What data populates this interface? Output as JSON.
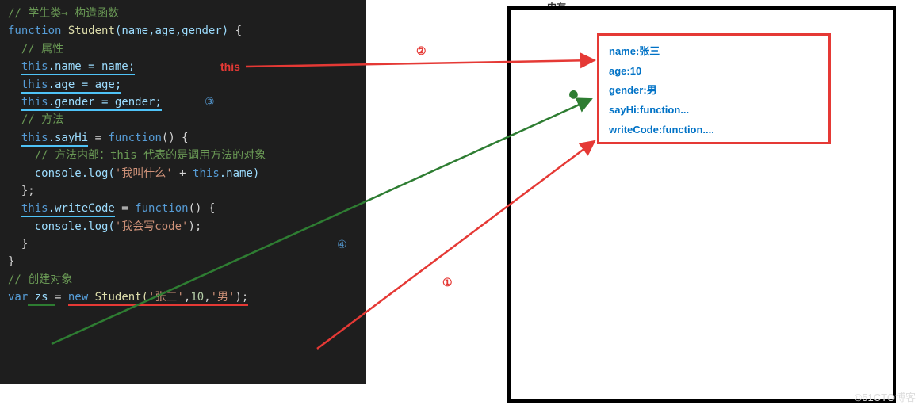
{
  "memory_title": "内存",
  "code": {
    "c1": "// 学生类→ 构造函数",
    "fn_kw": "function",
    "fn_name": "Student",
    "fn_params": "(name,age,gender)",
    "brace_open": " {",
    "c2": "// 属性",
    "p1_this": "this",
    "p1_prop": ".name = name;",
    "p2_this": "this",
    "p2_prop": ".age = age;",
    "p3_this": "this",
    "p3_prop": ".gender = gender;",
    "c3": "// 方法",
    "m1_this": "this",
    "m1_prop": ".sayHi",
    "m1_eq": " = ",
    "m1_fn": "function",
    "m1_rest": "() {",
    "c4": "// 方法内部：this 代表的是调用方法的对象",
    "log1_a": "console.log(",
    "log1_s": "'我叫什么'",
    "log1_b": " + ",
    "log1_this": "this",
    "log1_c": ".name)",
    "close1": "};",
    "m2_this": "this",
    "m2_prop": ".writeCode",
    "m2_eq": " = ",
    "m2_fn": "function",
    "m2_rest": "() {",
    "log2_a": "console.log(",
    "log2_s": "'我会写code'",
    "log2_b": ");",
    "close2": "}",
    "close3": "}",
    "c5": "// 创建对象",
    "var_kw": "var",
    "var_name": " zs ",
    "eq": "= ",
    "new_kw": "new",
    "ctor": " Student(",
    "arg1": "'张三'",
    "comma1": ",",
    "arg2": "10",
    "comma2": ",",
    "arg3": "'男'",
    "ctor_end": ");"
  },
  "obj": {
    "p1": "name:张三",
    "p2": "age:10",
    "p3": "gender:男",
    "p4": "sayHi:function...",
    "p5": "writeCode:function...."
  },
  "annotations": {
    "this_label": "this",
    "step1": "①",
    "step2": "②",
    "step3": "③",
    "step4": "④",
    "dot": "●"
  },
  "watermark": "©51CTO博客"
}
